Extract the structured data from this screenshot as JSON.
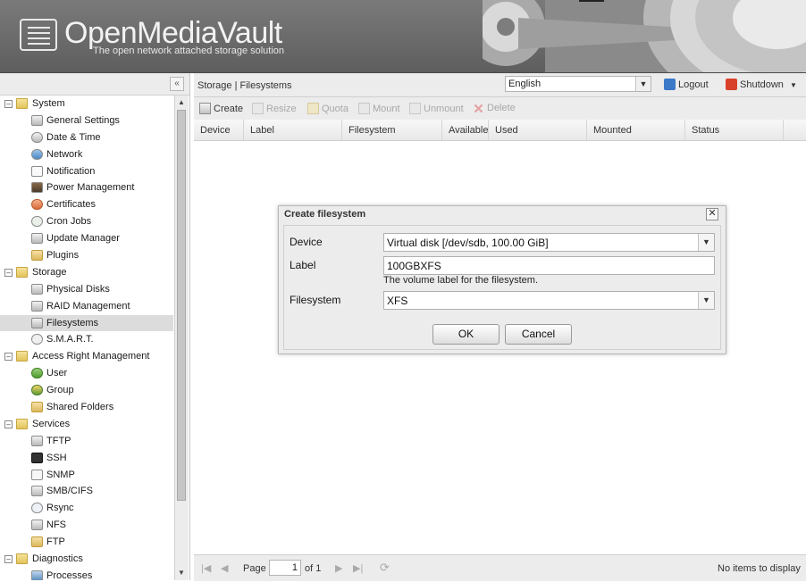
{
  "app": {
    "title": "OpenMediaVault",
    "subtitle": "The open network attached storage solution"
  },
  "header": {
    "language": "English",
    "logout_label": "Logout",
    "shutdown_label": "Shutdown"
  },
  "breadcrumb": "Storage | Filesystems",
  "nav": {
    "collapse_glyph": "«",
    "groups": [
      {
        "label": "System",
        "items": [
          "General Settings",
          "Date & Time",
          "Network",
          "Notification",
          "Power Management",
          "Certificates",
          "Cron Jobs",
          "Update Manager",
          "Plugins"
        ]
      },
      {
        "label": "Storage",
        "items": [
          "Physical Disks",
          "RAID Management",
          "Filesystems",
          "S.M.A.R.T."
        ]
      },
      {
        "label": "Access Right Management",
        "items": [
          "User",
          "Group",
          "Shared Folders"
        ]
      },
      {
        "label": "Services",
        "items": [
          "TFTP",
          "SSH",
          "SNMP",
          "SMB/CIFS",
          "Rsync",
          "NFS",
          "FTP"
        ]
      },
      {
        "label": "Diagnostics",
        "items": [
          "Processes"
        ]
      }
    ],
    "selected": "Filesystems"
  },
  "toolbar": {
    "create": "Create",
    "resize": "Resize",
    "quota": "Quota",
    "mount": "Mount",
    "unmount": "Unmount",
    "delete": "Delete"
  },
  "grid": {
    "columns": [
      "Device",
      "Label",
      "Filesystem",
      "Available",
      "Used",
      "Mounted",
      "Status"
    ]
  },
  "pager": {
    "page_label": "Page",
    "page_value": "1",
    "of_label": "of 1",
    "empty_text": "No items to display"
  },
  "dialog": {
    "title": "Create filesystem",
    "close_glyph": "✕",
    "device_label": "Device",
    "device_value": "Virtual disk [/dev/sdb, 100.00 GiB]",
    "label_label": "Label",
    "label_value": "100GBXFS",
    "label_hint": "The volume label for the filesystem.",
    "filesystem_label": "Filesystem",
    "filesystem_value": "XFS",
    "ok_label": "OK",
    "cancel_label": "Cancel"
  },
  "colors": {
    "header_bg": "#6b6b6b",
    "panel_bg": "#ececec",
    "selected_row": "#dcdcdc",
    "delete_icon": "#e05050",
    "shutdown_icon": "#d9402a",
    "logout_icon": "#3a78c8"
  }
}
